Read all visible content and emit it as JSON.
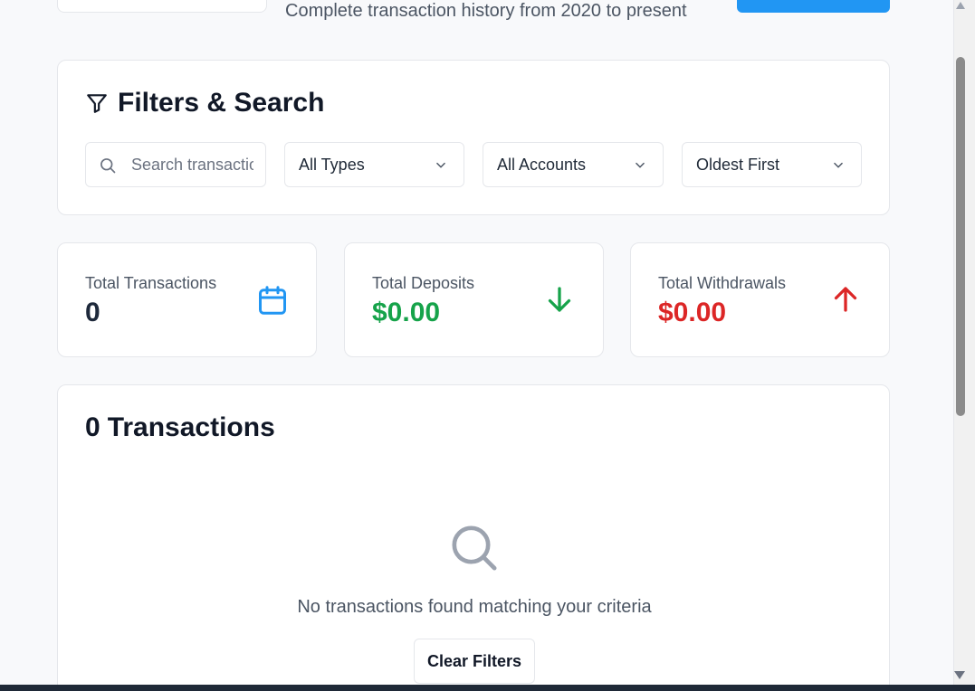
{
  "header": {
    "subtitle": "Complete transaction history from 2020 to present"
  },
  "filters": {
    "title": "Filters & Search",
    "search_placeholder": "Search transactions...",
    "type_select": "All Types",
    "account_select": "All Accounts",
    "sort_select": "Oldest First"
  },
  "stats": {
    "total_transactions": {
      "label": "Total Transactions",
      "value": "0",
      "icon": "calendar-icon"
    },
    "total_deposits": {
      "label": "Total Deposits",
      "value": "$0.00",
      "icon": "arrow-down-icon"
    },
    "total_withdrawals": {
      "label": "Total Withdrawals",
      "value": "$0.00",
      "icon": "arrow-up-icon"
    }
  },
  "transactions": {
    "count": "0",
    "title_suffix": "Transactions",
    "empty_message": "No transactions found matching your criteria",
    "clear_button": "Clear Filters"
  },
  "colors": {
    "primary": "#2196f3",
    "deposit": "#16a34a",
    "withdrawal": "#dc2626",
    "neutral_value": "#1e293b"
  }
}
